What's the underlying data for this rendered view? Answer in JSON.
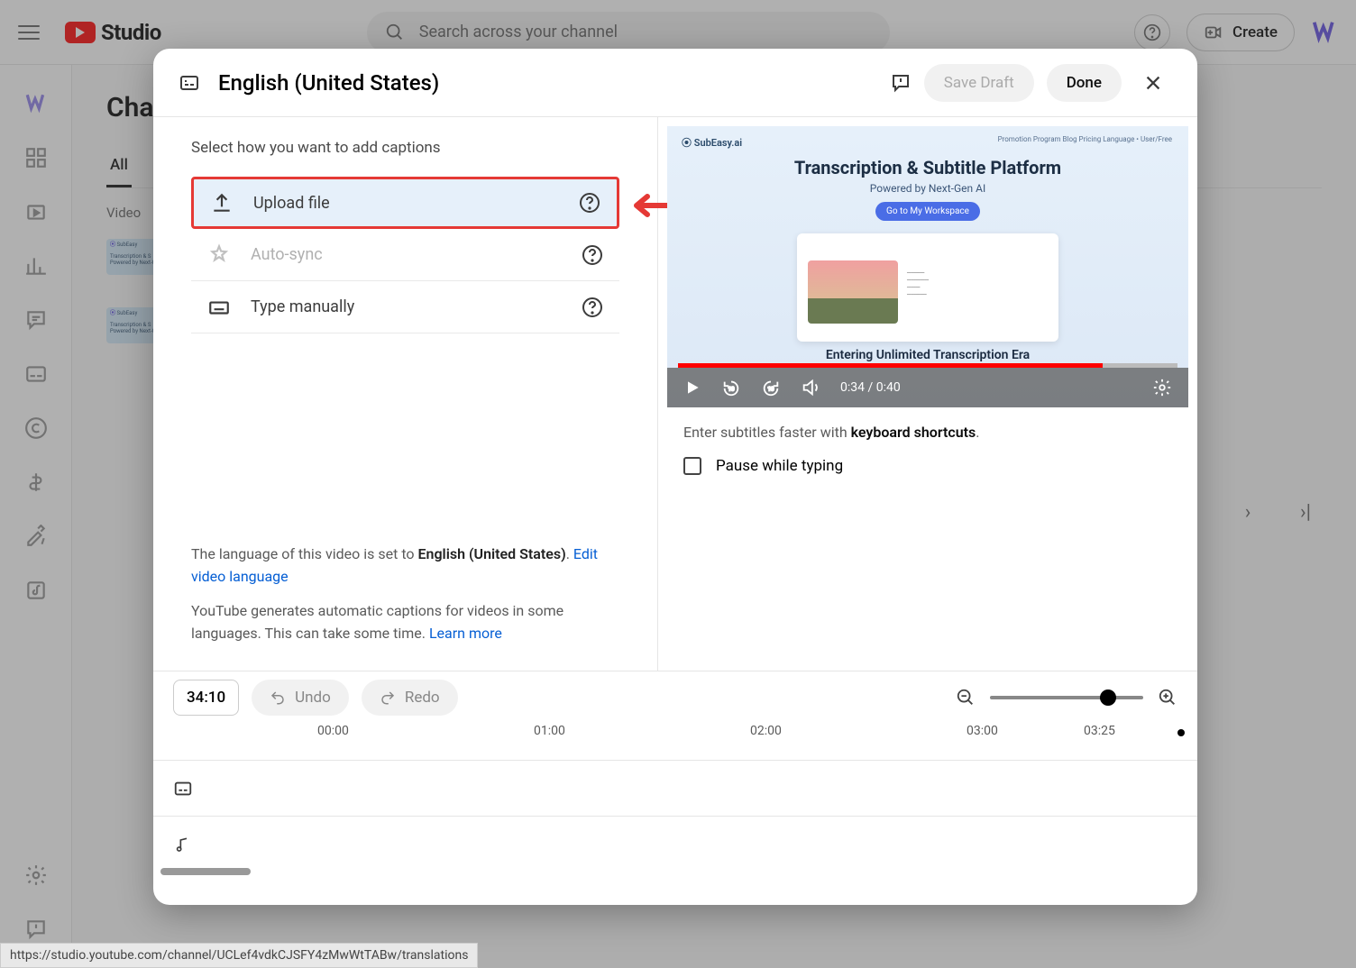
{
  "header": {
    "logo_text": "Studio",
    "search_placeholder": "Search across your channel",
    "create_label": "Create"
  },
  "sidebar": {
    "items": [
      "avatar",
      "dashboard",
      "content",
      "analytics",
      "comments",
      "subtitles",
      "copyright",
      "earn",
      "customize",
      "audio"
    ]
  },
  "background": {
    "page_title": "Cha",
    "active_tab": "All",
    "column_video": "Video",
    "thumb_logo": "SubEasy",
    "thumb_line1": "Transcription & S",
    "thumb_line2": "Powered by Next-G"
  },
  "modal": {
    "title": "English (United States)",
    "save_draft": "Save Draft",
    "done": "Done",
    "instruction": "Select how you want to add captions",
    "options": {
      "upload": "Upload file",
      "autosync": "Auto-sync",
      "type": "Type manually"
    },
    "info": {
      "prefix": "The language of this video is set to ",
      "language_bold": "English (United States)",
      "period": ". ",
      "edit_link": "Edit video language",
      "auto_text": "YouTube generates automatic captions for videos in some languages. This can take some time. ",
      "learn_more": "Learn more"
    },
    "video": {
      "logo": "⦿ SubEasy.ai",
      "nav": "Promotion Program   Blog   Pricing   Language   •  User/Free",
      "title": "Transcription & Subtitle Platform",
      "subtitle": "Powered by Next-Gen AI",
      "cta": "Go to My Workspace",
      "era_text": "Entering Unlimited Transcription Era",
      "current_time": "0:34",
      "total_time": "0:40"
    },
    "hints": {
      "enter_text": "Enter subtitles faster with ",
      "shortcuts_bold": "keyboard shortcuts",
      "period": ".",
      "pause_label": "Pause while typing"
    }
  },
  "timeline": {
    "time_input": "34:10",
    "undo": "Undo",
    "redo": "Redo",
    "ticks": [
      "00:00",
      "01:00",
      "02:00",
      "03:00",
      "03:25"
    ]
  },
  "status_url": "https://studio.youtube.com/channel/UCLef4vdkCJSFY4zMwWtTABw/translations"
}
